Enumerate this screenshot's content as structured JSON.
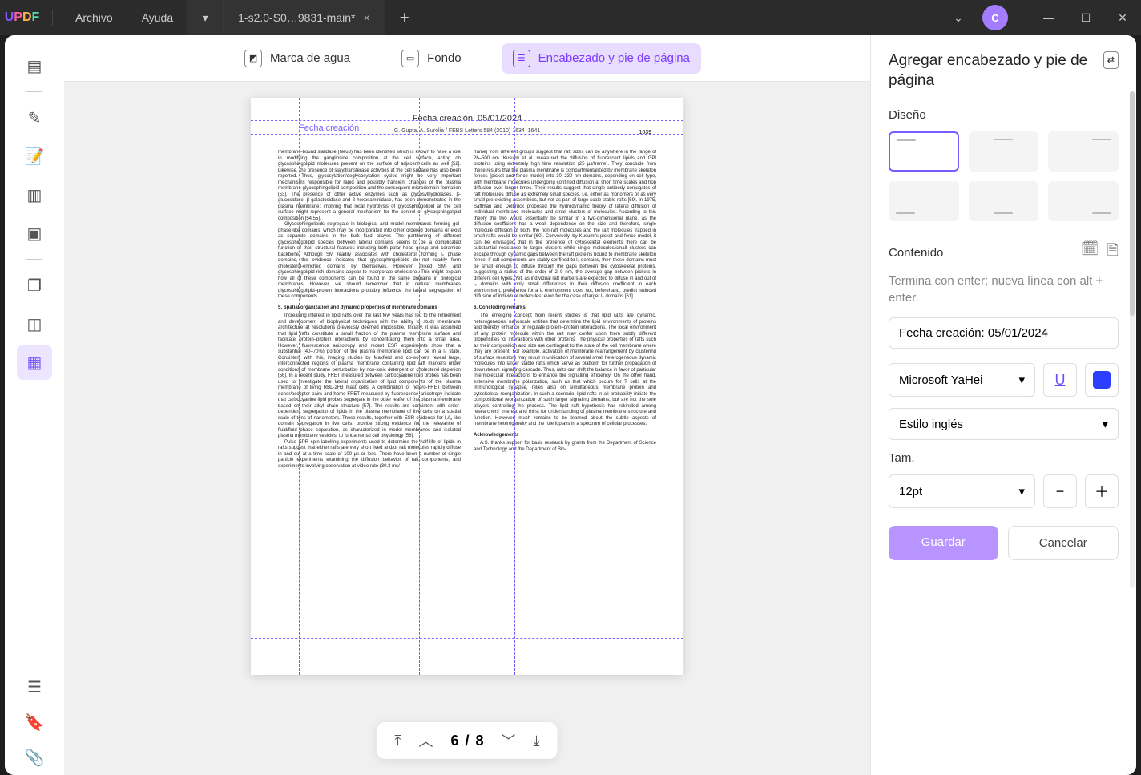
{
  "menu": {
    "file": "Archivo",
    "help": "Ayuda"
  },
  "tab": {
    "name": "1-s2.0-S0…9831-main*",
    "close": "×"
  },
  "avatar": "C",
  "toolbar": {
    "watermark": "Marca de agua",
    "background": "Fondo",
    "headerfooter": "Encabezado y pie de página"
  },
  "page": {
    "header": "Fecha creación: 05/01/2024",
    "label": "Fecha creación",
    "meta": "G. Gupta, A. Surolia / FEBS Letters 584 (2010) 1634–1641",
    "num": "1639",
    "sec5": "5. Spatial organization and dynamic properties of membrane domains",
    "sec6": "6. Concluding remarks",
    "ack": "Acknowledgements",
    "col1a": "membrane-bound sialidase (Neu3) has been identified which is known to have a role in modifying the ganglioside composition at the cell surface, acting on glycosphingolipid molecules present on the surface of adjacent cells as well [52]. Likewise, the presence of sialyltransferase activities at the cell surface has also been reported. Thus, glycosylation/deglycosylation cycles might be very important mechanisms responsible for rapid and possibly transient changes of the plasma membrane glycosphingolipid composition and the consequent microdomain formation [53]. The presence of other active enzymes such as glycosylhydrolases, β-glucosidase, β-galactosidase and β-hexosaminidase, has been demonstrated in the plasma membrane; implying that local hydrolysis of glycosphingolipid at the cell surface might represent a general mechanism for the control of glycosphingolipid composition [54,55].",
    "col1b": "Glycosphingolipids segregate in biological and model membranes forming gel-phase-like domains, which may be incorporated into other ordered domains or exist as separate domains in the bulk fluid bilayer. The partitioning of different glycosphingolipid species between lateral domains seems to be a complicated function of their structural features including both polar head group and ceramide backbone. Although SM readily associates with cholesterol, forming l₀ phase domains, the evidence indicates that glycosphingolipids do not readily form cholesterol-enriched domains by themselves. However, mixed SM- and glycosphingolipid-rich domains appear to incorporate cholesterol. This might explain how all of these components can be found in the same domains in biological membranes. However, we should remember that in cellular membranes glycosphingolipid–protein interactions probably influence the lateral segregation of these components.",
    "col1c": "Increasing interest in lipid rafts over the last few years has led to the refinement and development of biophysical techniques with the ability to study membrane architecture at resolutions previously deemed impossible. Initially, it was assumed that lipid rafts constitute a small fraction of the plasma membrane surface and facilitate protein–protein interactions by concentrating them into a small area. However, fluorescence anisotropy and recent ESR experiments show that a substantial (40–70%) portion of the plasma membrane lipid can be in a l₀ state. Consistent with this, imaging studies by Maxfield and co-workers reveal large, interconnected regions of plasma membrane containing lipid raft markers under conditions of membrane perturbation by non-ionic detergent or cholesterol depletion [56]. In a recent study, FRET measured between carbocyanine lipid probes has been used to investigate the lateral organization of lipid components of the plasma membrane of living RBL-2H3 mast cells. A combination of hetero-FRET between donor/acceptor pairs and homo-FRET measured by fluorescence anisotropy indicate that carbocyanine lipid probes segregate in the outer leaflet of the plasma membrane based on their alkyl chain structure [57]. The results are consistent with order-dependent segregation of lipids in the plasma membrane of live cells on a spatial scale of tens of nanometers. These results, together with ESR evidence for l₀/lₐ-like domain segregation in live cells, provide strong evidence for the relevance of fluid/fluid phase separation, as characterized in model membranes and isolated plasma membrane vesicles, to fundamental cell physiology [58].",
    "col1d": "Pulse EPR spin-labelling experiments used to determine the half-life of lipids in rafts suggest that either rafts are very short lived and/or raft molecules rapidly diffuse in and out at a time scale of 100 μs or less. There have been a number of single particle experiments examining the diffusion behavior of raft components, and experiments involving observation at video rate (30.3 ms/",
    "col2a": "frame) from different groups suggest that raft sizes can be anywhere in the range of 26–500 nm. Kusumi et al. measured the diffusion of fluorescent lipids and GPI proteins using extremely high time resolution (25 μs/frame). They conclude from these results that the plasma membrane is compartmentalized by membrane skeleton fences (picket and fence model) into 30–230 nm domains, depending on cell type, with membrane molecules undergoing confined diffusion at short time scales and hop diffusion over longer times. Their results suggest that single antibody conjugates of raft molecules diffuse as extremely small species, i.e. either as monomers or as very small pre-existing assemblies, but not as part of large-scale stable rafts [59]. In 1975, Saffman and Delbrück proposed the hydrodynamic theory of lateral diffusion of individual membrane molecules and small clusters of molecules. According to this theory the two would essentially be similar in a two-dimensional plane, as the diffusion coefficient has a weak dependence on the size and therefore, single molecule diffusion of both, the non-raft molecules and the raft molecules trapped in small rafts would be similar [60]. Conversely, by Kusumi's picket and fence model, it can be envisaged that in the presence of cytoskeletal elements there can be substantial resistance to larger clusters while single molecules/small clusters can escape through dynamic gaps between the raft proteins bound to membrane skeleton fence. If raft components are stably confined to l₀ domains, then these domains must be small enough to diffuse through the gaps between the cytoskeletal proteins, suggesting a radius of the order of 2–9 nm, the average gap between pickets in different cell types. Yet, as individual raft markers are expected to diffuse in and out of l₀ domains with only small differences in their diffusion coefficient in each environment, preference for a l₀ environment does not, beforehand, predict reduced diffusion of individual molecules, even for the case of larger l₀ domains [61].",
    "col2b": "The emerging concept from recent studies is that lipid rafts are dynamic, heterogeneous, nanoscale entities that determine the lipid environments of proteins and thereby enhance or regulate protein–protein interactions. The local environment of any protein molecule within the raft may confer upon them subtly different propensities for interactions with other proteins. The physical properties of rafts such as their composition and size are contingent to the state of the cell membrane where they are present. For example, activation of membrane rearrangement by clustering of surface receptors may result in unification of several small heterogeneous dynamic molecules into larger stable rafts which serve as platform for further propagation of downstream signalling cascade. Thus, rafts can shift the balance in favor of particular intermolecular interactions to enhance the signalling efficiency. On the other hand, extensive membrane polarization, such as that which occurs for T cells at the immunological synapse, relies also on simultaneous membrane protein and cytoskeletal reorganization. In such a scenario, lipid rafts in all probability initiate the compositional reorganization of such larger signaling domains, but are not the sole players controlling the process. The lipid raft hypothesis has rekindled among researchers' interest and thirst for understanding of plasma membrane structure and function. However, much remains to be learned about the subtle aspects of membrane heterogeneity and the role it plays in a spectrum of cellular processes.",
    "col2c": "A.S. thanks support for basic research by grants from the Department of Science and Technology and the Department of Bio-"
  },
  "pager": {
    "current": "6",
    "sep": "/",
    "total": "8"
  },
  "right": {
    "title": "Agregar encabezado y pie de página",
    "design": "Diseño",
    "content": "Contenido",
    "hint": "Termina con enter; nueva línea con alt + enter.",
    "value": "Fecha creación: 05/01/2024",
    "font": "Microsoft YaHei",
    "style": "Estilo inglés",
    "size_label": "Tam.",
    "size": "12pt",
    "save": "Guardar",
    "cancel": "Cancelar"
  }
}
